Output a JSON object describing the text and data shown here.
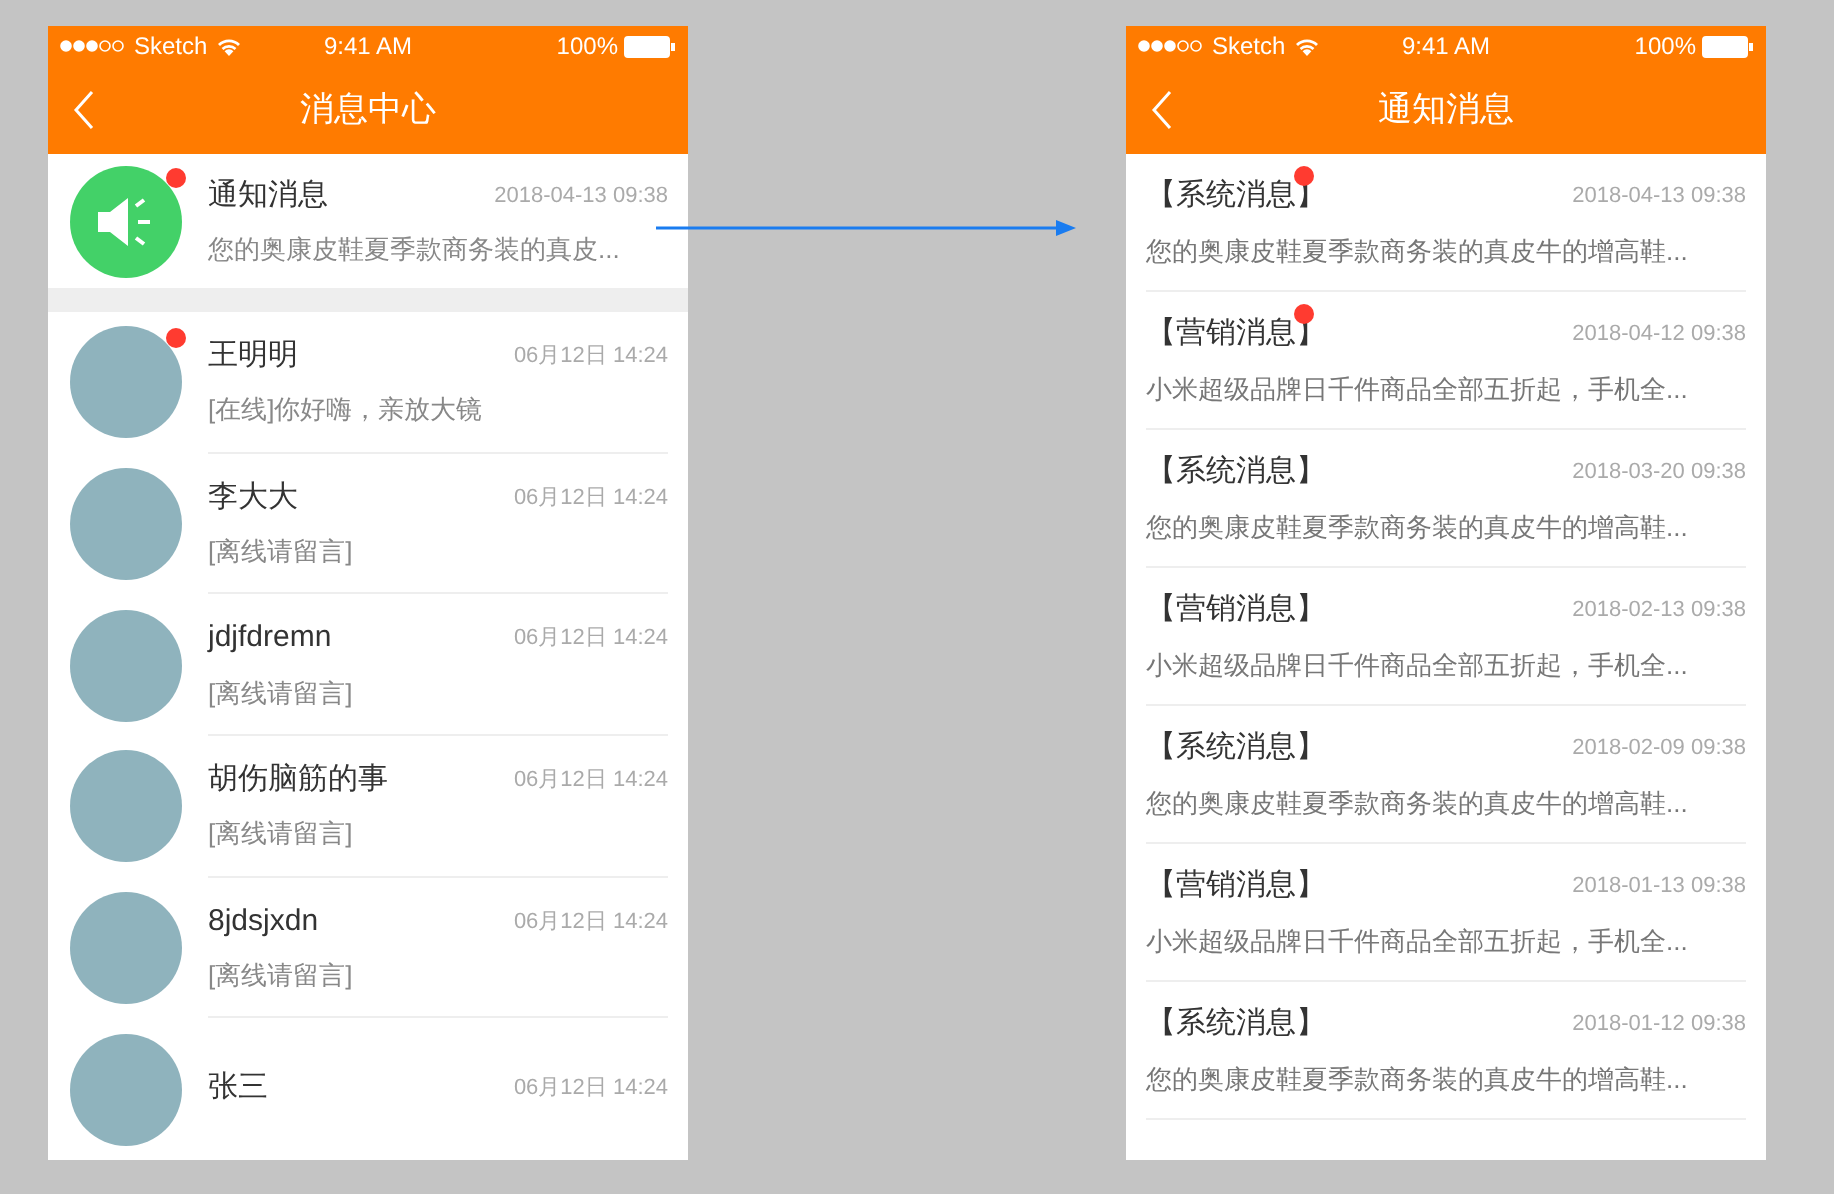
{
  "left_screen": {
    "status_bar": {
      "carrier": "Sketch",
      "time": "9:41 AM",
      "battery": "100%"
    },
    "nav": {
      "title": "消息中心"
    },
    "items": [
      {
        "kind": "notice",
        "name": "通知消息",
        "time": "2018-04-13 09:38",
        "preview": "您的奥康皮鞋夏季款商务装的真皮...",
        "unread": true
      },
      {
        "kind": "contact",
        "name": "王明明",
        "time": "06月12日 14:24",
        "preview": "[在线]你好嗨，亲放大镜",
        "unread": true
      },
      {
        "kind": "contact",
        "name": "李大大",
        "time": "06月12日 14:24",
        "preview": "[离线请留言]",
        "unread": false
      },
      {
        "kind": "contact",
        "name": "jdjfdremn",
        "time": "06月12日 14:24",
        "preview": "[离线请留言]",
        "unread": false
      },
      {
        "kind": "contact",
        "name": "胡伤脑筋的事",
        "time": "06月12日 14:24",
        "preview": "[离线请留言]",
        "unread": false
      },
      {
        "kind": "contact",
        "name": "8jdsjxdn",
        "time": "06月12日 14:24",
        "preview": "[离线请留言]",
        "unread": false
      },
      {
        "kind": "contact",
        "name": "张三",
        "time": "06月12日 14:24",
        "unread": false
      }
    ]
  },
  "right_screen": {
    "status_bar": {
      "carrier": "Sketch",
      "time": "9:41 AM",
      "battery": "100%"
    },
    "nav": {
      "title": "通知消息"
    },
    "items": [
      {
        "title": "【系统消息】",
        "time": "2018-04-13 09:38",
        "preview": "您的奥康皮鞋夏季款商务装的真皮牛的增高鞋...",
        "unread": true
      },
      {
        "title": "【营销消息】",
        "time": "2018-04-12 09:38",
        "preview": "小米超级品牌日千件商品全部五折起，手机全...",
        "unread": true
      },
      {
        "title": "【系统消息】",
        "time": "2018-03-20 09:38",
        "preview": "您的奥康皮鞋夏季款商务装的真皮牛的增高鞋...",
        "unread": false
      },
      {
        "title": "【营销消息】",
        "time": "2018-02-13 09:38",
        "preview": "小米超级品牌日千件商品全部五折起，手机全...",
        "unread": false
      },
      {
        "title": "【系统消息】",
        "time": "2018-02-09 09:38",
        "preview": "您的奥康皮鞋夏季款商务装的真皮牛的增高鞋...",
        "unread": false
      },
      {
        "title": "【营销消息】",
        "time": "2018-01-13 09:38",
        "preview": "小米超级品牌日千件商品全部五折起，手机全...",
        "unread": false
      },
      {
        "title": "【系统消息】",
        "time": "2018-01-12 09:38",
        "preview": "您的奥康皮鞋夏季款商务装的真皮牛的增高鞋...",
        "unread": false
      }
    ]
  }
}
